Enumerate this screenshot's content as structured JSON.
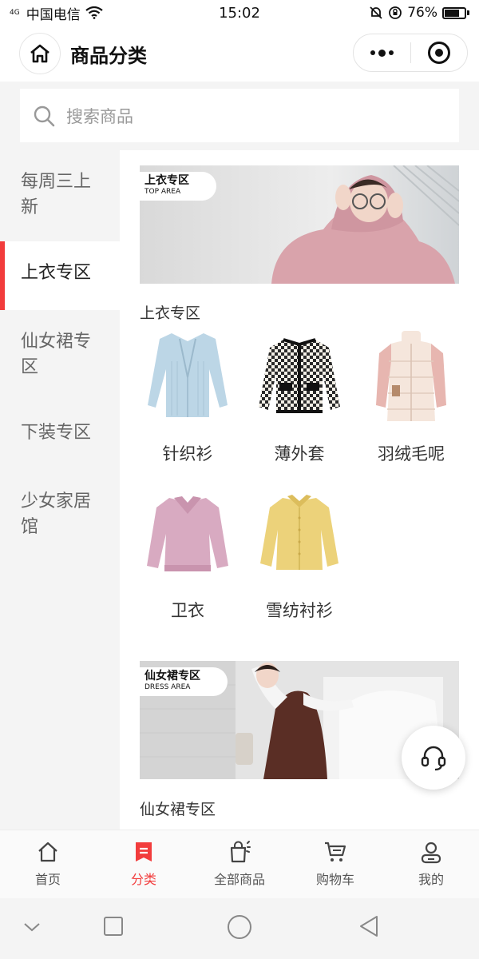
{
  "status_bar": {
    "network_type": "4G",
    "carrier": "中国电信",
    "time": "15:02",
    "battery_percent": "76%",
    "battery_level": 0.76
  },
  "header": {
    "title": "商品分类",
    "home_icon": "home-icon",
    "more_icon": "more-dots-icon",
    "close_icon": "target-icon"
  },
  "search": {
    "placeholder": "搜索商品",
    "icon": "search-icon"
  },
  "sidebar": {
    "items": [
      {
        "label": "每周三上新",
        "active": false
      },
      {
        "label": "上衣专区",
        "active": true
      },
      {
        "label": "仙女裙专区",
        "active": false
      },
      {
        "label": "下装专区",
        "active": false
      },
      {
        "label": "少女家居馆",
        "active": false
      }
    ]
  },
  "content": {
    "sections": [
      {
        "banner_tag_cn": "上衣专区",
        "banner_tag_en": "TOP AREA",
        "title": "上衣专区",
        "categories": [
          {
            "label": "针织衫",
            "icon": "knit-cardigan-image"
          },
          {
            "label": "薄外套",
            "icon": "tweed-jacket-image"
          },
          {
            "label": "羽绒毛呢",
            "icon": "down-coat-image"
          },
          {
            "label": "卫衣",
            "icon": "sweatshirt-image"
          },
          {
            "label": "雪纺衬衫",
            "icon": "chiffon-shirt-image"
          }
        ]
      },
      {
        "banner_tag_cn": "仙女裙专区",
        "banner_tag_en": "DRESS AREA",
        "title": "仙女裙专区"
      }
    ]
  },
  "support": {
    "icon": "headset-icon"
  },
  "tabbar": {
    "tabs": [
      {
        "label": "首页",
        "icon": "home-icon",
        "active": false
      },
      {
        "label": "分类",
        "icon": "category-icon",
        "active": true
      },
      {
        "label": "全部商品",
        "icon": "shopping-bag-icon",
        "active": false
      },
      {
        "label": "购物车",
        "icon": "cart-icon",
        "active": false
      },
      {
        "label": "我的",
        "icon": "user-icon",
        "active": false
      }
    ]
  },
  "colors": {
    "accent": "#f23c3c",
    "background": "#f4f4f4"
  }
}
